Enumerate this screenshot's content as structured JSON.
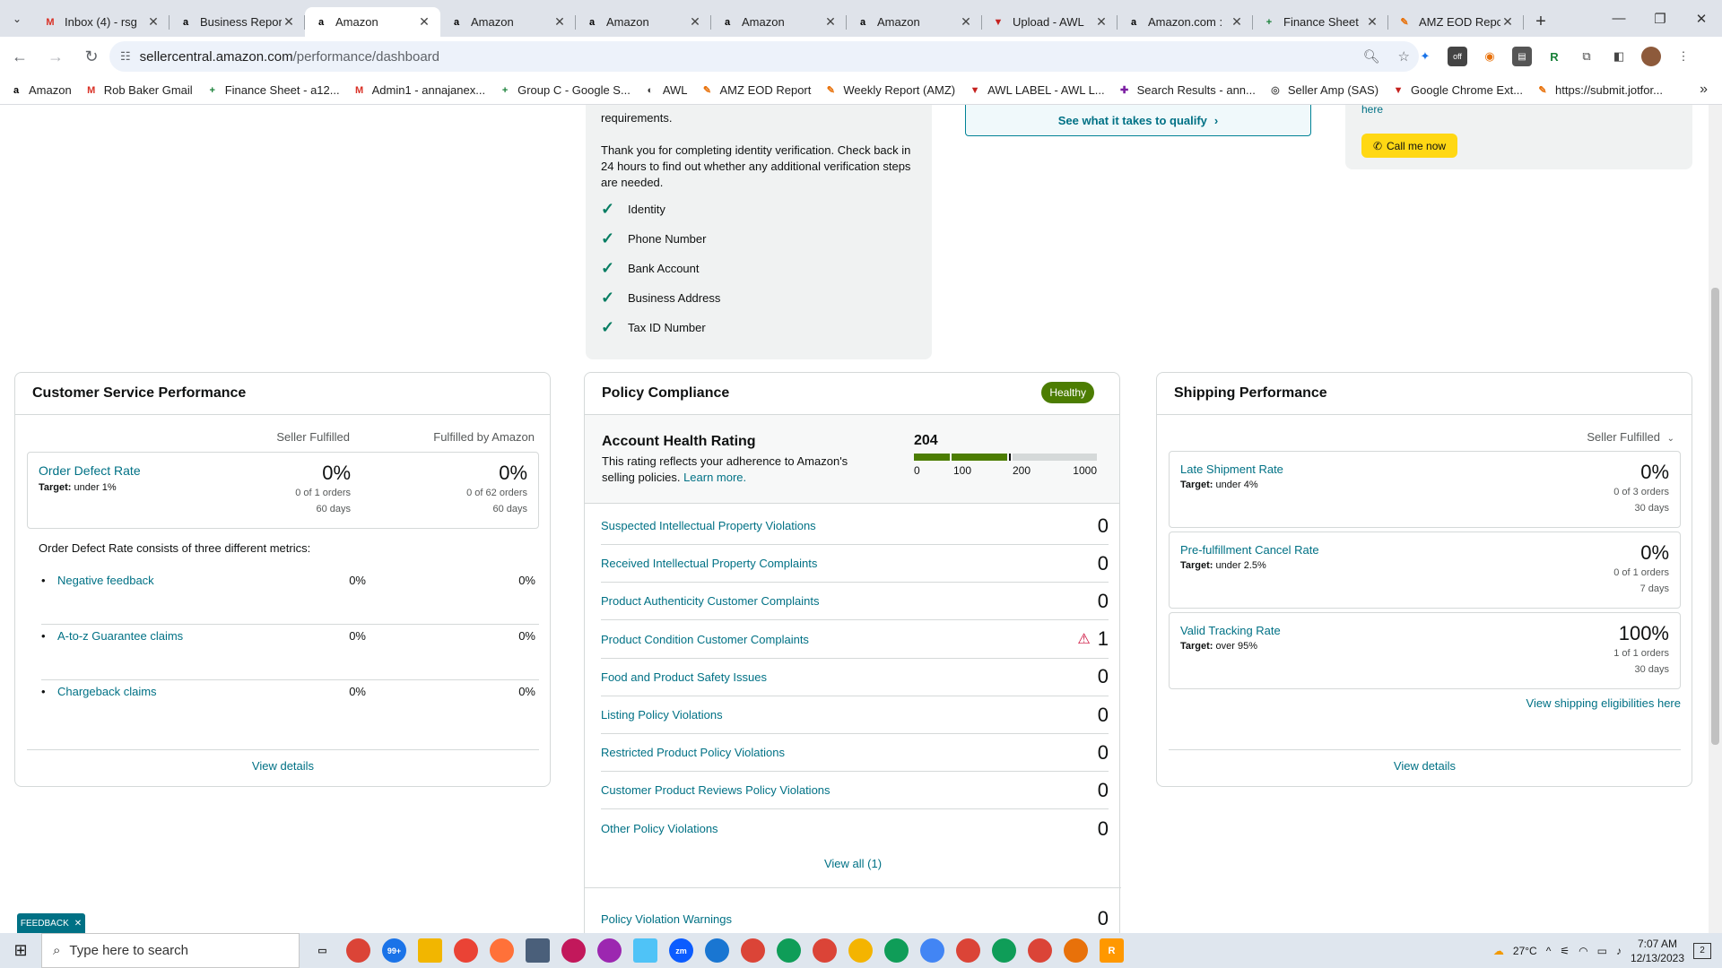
{
  "browser": {
    "tabs": [
      {
        "title": "Inbox (4) - rsg",
        "icon": "gmail-icon",
        "color": "#d93025",
        "glyph": "M"
      },
      {
        "title": "Business Repor",
        "icon": "amazon-icon",
        "color": "#000000",
        "glyph": "a"
      },
      {
        "title": "Amazon",
        "icon": "amazon-icon",
        "color": "#000000",
        "glyph": "a",
        "active": true
      },
      {
        "title": "Amazon",
        "icon": "amazon-icon",
        "color": "#000000",
        "glyph": "a"
      },
      {
        "title": "Amazon",
        "icon": "amazon-icon",
        "color": "#000000",
        "glyph": "a"
      },
      {
        "title": "Amazon",
        "icon": "amazon-icon",
        "color": "#000000",
        "glyph": "a"
      },
      {
        "title": "Amazon",
        "icon": "amazon-icon",
        "color": "#000000",
        "glyph": "a"
      },
      {
        "title": "Upload - AWL",
        "icon": "awl-icon",
        "color": "#c5221f",
        "glyph": "▼"
      },
      {
        "title": "Amazon.com :",
        "icon": "amazon-icon",
        "color": "#000000",
        "glyph": "a"
      },
      {
        "title": "Finance Sheet",
        "icon": "sheets-icon",
        "color": "#188038",
        "glyph": "+"
      },
      {
        "title": "AMZ EOD Repo",
        "icon": "report-icon",
        "color": "#e8710a",
        "glyph": "✎"
      }
    ],
    "url_host": "sellercentral.amazon.com",
    "url_path": "/performance/dashboard",
    "bookmarks": [
      {
        "label": "Amazon",
        "color": "#000000",
        "glyph": "a"
      },
      {
        "label": "Rob Baker Gmail",
        "color": "#d93025",
        "glyph": "M"
      },
      {
        "label": "Finance Sheet - a12...",
        "color": "#188038",
        "glyph": "+"
      },
      {
        "label": "Admin1 - annajanex...",
        "color": "#d93025",
        "glyph": "M"
      },
      {
        "label": "Group C - Google S...",
        "color": "#188038",
        "glyph": "+"
      },
      {
        "label": "AWL",
        "color": "#333333",
        "glyph": "◐"
      },
      {
        "label": "AMZ EOD Report",
        "color": "#e8710a",
        "glyph": "✎"
      },
      {
        "label": "Weekly Report (AMZ)",
        "color": "#e8710a",
        "glyph": "✎"
      },
      {
        "label": "AWL LABEL - AWL L...",
        "color": "#c5221f",
        "glyph": "▼"
      },
      {
        "label": "Search Results - ann...",
        "color": "#7b1fa2",
        "glyph": "✚"
      },
      {
        "label": "Seller Amp (SAS)",
        "color": "#555555",
        "glyph": "◎"
      },
      {
        "label": "Google Chrome Ext...",
        "color": "#c5221f",
        "glyph": "▼"
      },
      {
        "label": "https://submit.jotfor...",
        "color": "#e8710a",
        "glyph": "✎"
      }
    ]
  },
  "verification": {
    "partial_text": "requirements.",
    "thanks_text": "Thank you for completing identity verification. Check back in 24 hours to find out whether any additional verification steps are needed.",
    "items": [
      "Identity",
      "Phone Number",
      "Bank Account",
      "Business Address",
      "Tax ID Number"
    ]
  },
  "qualify_label": "See what it takes to qualify",
  "call": {
    "partial_link": "here",
    "button": "Call me now"
  },
  "customer_service": {
    "title": "Customer Service Performance",
    "col1": "Seller Fulfilled",
    "col2": "Fulfilled by Amazon",
    "odr_label": "Order Defect Rate",
    "odr_target_label": "Target:",
    "odr_target": "under 1%",
    "sf_value": "0%",
    "sf_orders": "0 of 1 orders",
    "sf_days": "60 days",
    "fba_value": "0%",
    "fba_orders": "0 of 62 orders",
    "fba_days": "60 days",
    "consists_text": "Order Defect Rate consists of three different metrics:",
    "metrics": [
      {
        "label": "Negative feedback",
        "sf": "0%",
        "fba": "0%"
      },
      {
        "label": "A-to-z Guarantee claims",
        "sf": "0%",
        "fba": "0%"
      },
      {
        "label": "Chargeback claims",
        "sf": "0%",
        "fba": "0%"
      }
    ],
    "view_details": "View details"
  },
  "policy": {
    "title": "Policy Compliance",
    "badge": "Healthy",
    "ahr_title": "Account Health Rating",
    "ahr_desc": "This rating reflects your adherence to Amazon's selling policies.",
    "ahr_learn": "Learn more.",
    "ahr_score": "204",
    "ahr_score_value": 204,
    "scale": [
      "0",
      "100",
      "200",
      "1000"
    ],
    "rows": [
      {
        "label": "Suspected Intellectual Property Violations",
        "value": "0"
      },
      {
        "label": "Received Intellectual Property Complaints",
        "value": "0"
      },
      {
        "label": "Product Authenticity Customer Complaints",
        "value": "0"
      },
      {
        "label": "Product Condition Customer Complaints",
        "value": "1",
        "warn": true
      },
      {
        "label": "Food and Product Safety Issues",
        "value": "0"
      },
      {
        "label": "Listing Policy Violations",
        "value": "0"
      },
      {
        "label": "Restricted Product Policy Violations",
        "value": "0"
      },
      {
        "label": "Customer Product Reviews Policy Violations",
        "value": "0"
      },
      {
        "label": "Other Policy Violations",
        "value": "0"
      }
    ],
    "view_all": "View all (1)",
    "warnings_label": "Policy Violation Warnings",
    "warnings_value": "0"
  },
  "shipping": {
    "title": "Shipping Performance",
    "filter": "Seller Fulfilled",
    "metrics": [
      {
        "label": "Late Shipment Rate",
        "target": "under 4%",
        "value": "0%",
        "orders": "0 of 3 orders",
        "days": "30 days"
      },
      {
        "label": "Pre-fulfillment Cancel Rate",
        "target": "under 2.5%",
        "value": "0%",
        "orders": "0 of 1 orders",
        "days": "7 days"
      },
      {
        "label": "Valid Tracking Rate",
        "target": "over 95%",
        "value": "100%",
        "orders": "1 of 1 orders",
        "days": "30 days"
      }
    ],
    "target_label": "Target:",
    "eligibility_link": "View shipping eligibilities here",
    "view_details": "View details"
  },
  "feedback_label": "FEEDBACK",
  "taskbar": {
    "search_placeholder": "Type here to search",
    "badge": "99+",
    "temperature": "27°C",
    "time": "7:07 AM",
    "date": "12/13/2023",
    "notif_count": "2"
  },
  "colors": {
    "link": "#007185",
    "healthy": "#4c7d02",
    "check": "#067d62",
    "warn": "#cc0c39",
    "yellow": "#ffd814"
  }
}
